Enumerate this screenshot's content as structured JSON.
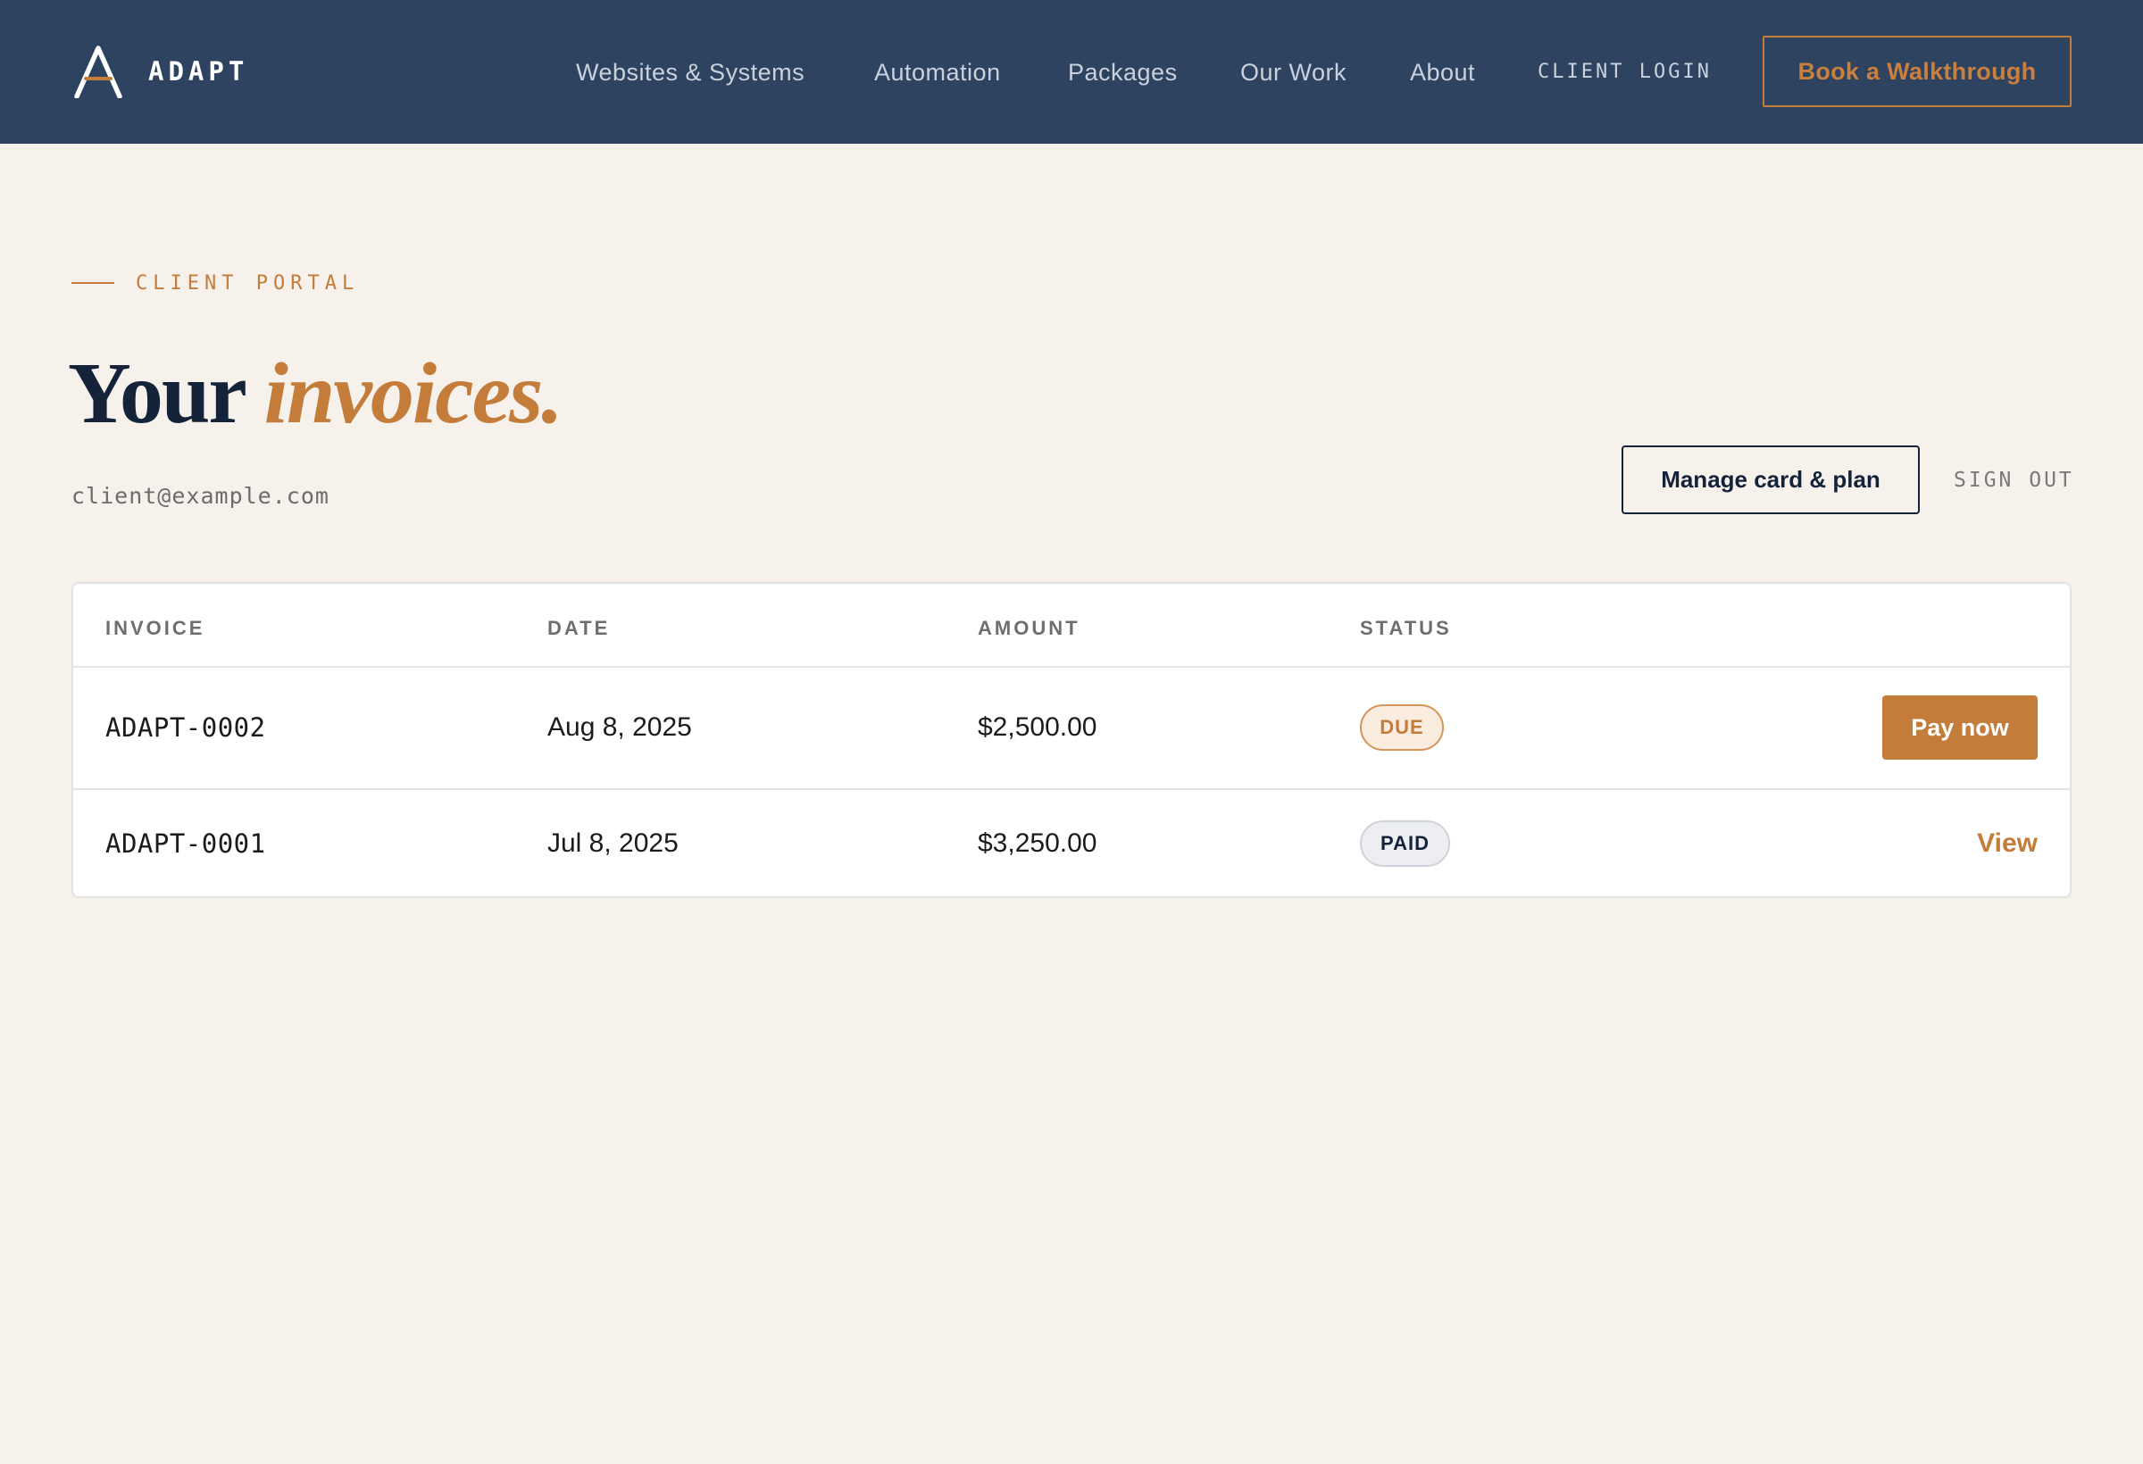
{
  "header": {
    "brand_name": "ADAPT",
    "brand_logo_icon": "adapt-a-logo-icon",
    "nav": {
      "websites": "Websites & Systems",
      "automation": "Automation",
      "packages": "Packages",
      "our_work": "Our Work",
      "about": "About",
      "client_login": "CLIENT LOGIN"
    },
    "cta_label": "Book a Walkthrough"
  },
  "hero": {
    "eyebrow": "CLIENT PORTAL",
    "title_main": "Your",
    "title_accent": "invoices.",
    "email": "client@example.com",
    "manage_label": "Manage card & plan",
    "signout_label": "SIGN OUT"
  },
  "invoices": {
    "columns": {
      "invoice": "INVOICE",
      "date": "DATE",
      "amount": "AMOUNT",
      "status": "STATUS"
    },
    "rows": [
      {
        "id": "ADAPT-0002",
        "date": "Aug 8, 2025",
        "amount": "$2,500.00",
        "status": "DUE",
        "action": "Pay now"
      },
      {
        "id": "ADAPT-0001",
        "date": "Jul 8, 2025",
        "amount": "$3,250.00",
        "status": "PAID",
        "action": "View"
      }
    ]
  },
  "colors": {
    "header_bg": "#2e4360",
    "page_bg": "#f6f1eb",
    "accent": "#c47c3a",
    "navy": "#14233a"
  }
}
